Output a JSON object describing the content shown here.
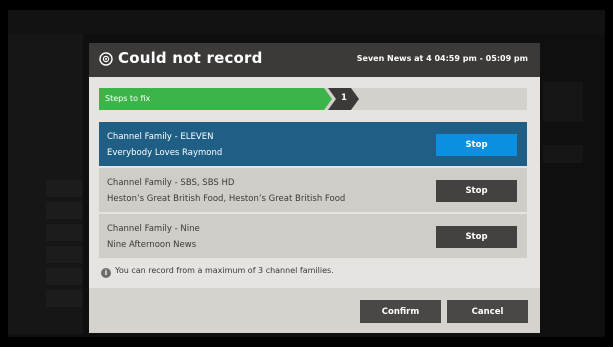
{
  "dialog": {
    "title": "Could not record",
    "subtitle": "Seven News at 4 04:59 pm - 05:09 pm",
    "logo_icon": "record-icon"
  },
  "steps": {
    "label": "Steps to fix",
    "current": "1",
    "colors": {
      "active": "#3bb54a",
      "number": "#3b3a38",
      "track": "#d4d1cd"
    }
  },
  "conflicts": [
    {
      "family": "Channel Family - ELEVEN",
      "program": "Everybody Loves Raymond",
      "button": "Stop",
      "selected": true
    },
    {
      "family": "Channel Family - SBS, SBS HD",
      "program": "Heston’s Great British Food, Heston’s Great British Food",
      "button": "Stop",
      "selected": false
    },
    {
      "family": "Channel Family - Nine",
      "program": "Nine Afternoon News",
      "button": "Stop",
      "selected": false
    }
  ],
  "info": {
    "icon": "info-icon",
    "text": "You can record from a maximum of 3 channel families."
  },
  "footer": {
    "confirm": "Confirm",
    "cancel": "Cancel"
  },
  "colors": {
    "header_bg": "#3b3a38",
    "selected_row": "#1f5f86",
    "selected_button": "#0b8fe0",
    "button_dark": "#444240"
  }
}
